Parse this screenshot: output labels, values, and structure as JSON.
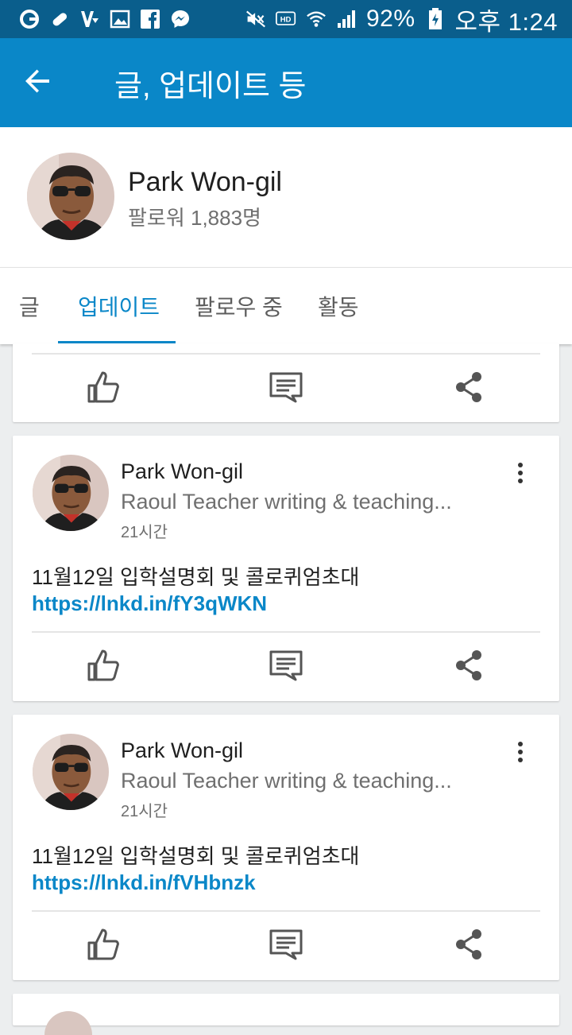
{
  "status_bar": {
    "battery": "92%",
    "time": "오후 1:24",
    "icons_left": [
      "g-icon",
      "pill-icon",
      "v-icon",
      "gallery-icon",
      "facebook-icon",
      "messenger-icon"
    ],
    "icons_right": [
      "mute-icon",
      "hd-icon",
      "wifi-icon",
      "signal-icon",
      "battery-icon"
    ]
  },
  "appbar": {
    "title": "글, 업데이트 등"
  },
  "profile": {
    "name": "Park Won-gil",
    "followers": "팔로워 1,883명"
  },
  "tabs": [
    {
      "label": "글"
    },
    {
      "label": "업데이트"
    },
    {
      "label": "팔로우 중"
    },
    {
      "label": "활동"
    }
  ],
  "posts": [
    {
      "author": "Park Won-gil",
      "headline": "Raoul Teacher writing & teaching...",
      "time": "21시간",
      "text": "11월12일 입학설명회 및 콜로퀴엄초대 ",
      "link": "https://lnkd.in/fY3qWKN"
    },
    {
      "author": "Park Won-gil",
      "headline": "Raoul Teacher writing & teaching...",
      "time": "21시간",
      "text": "11월12일 입학설명회 및 콜로퀴엄초대 ",
      "link": "https://lnkd.in/fVHbnzk"
    }
  ],
  "colors": {
    "primary": "#0a87c8",
    "status_bar": "#0a5e8c"
  }
}
